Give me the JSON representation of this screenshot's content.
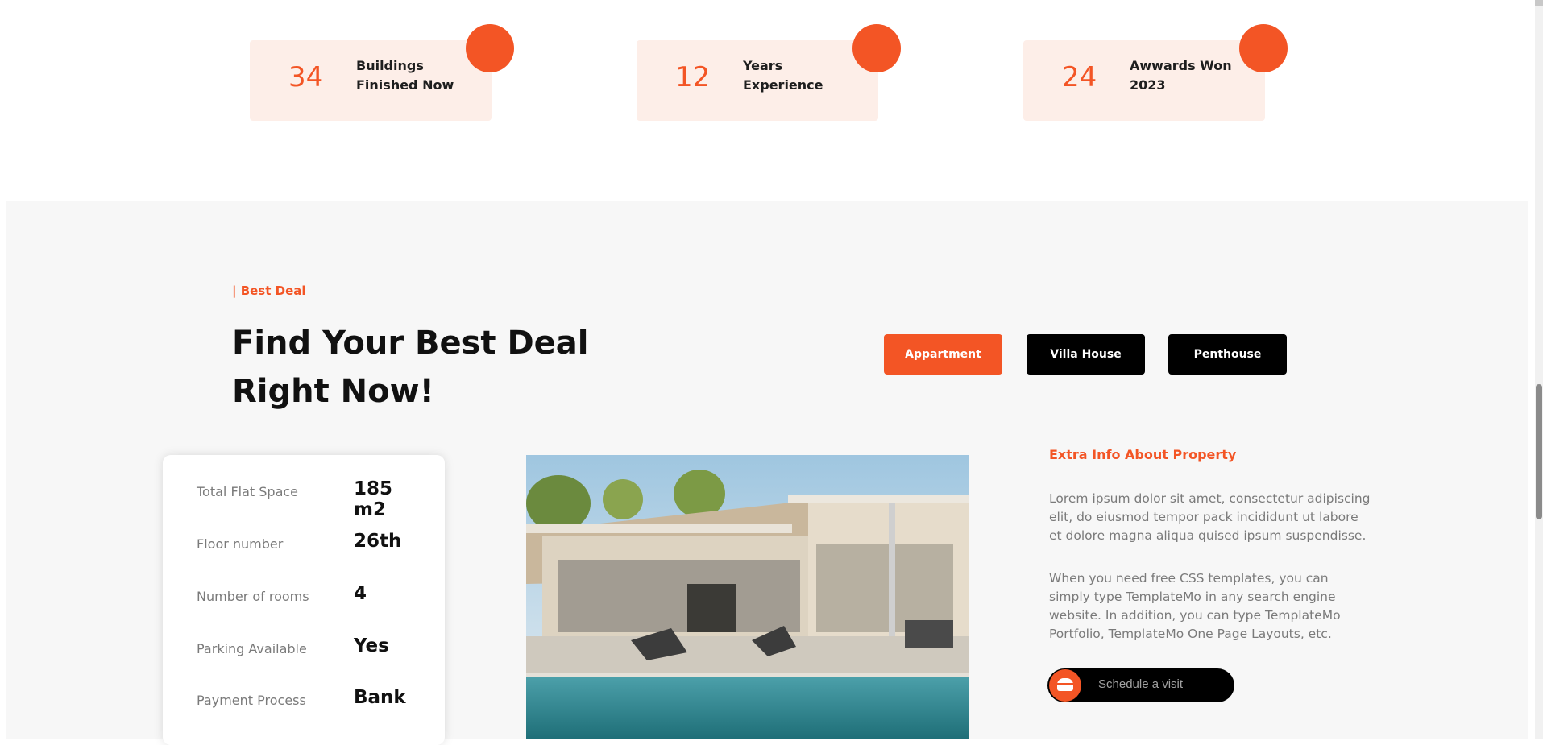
{
  "stats": [
    {
      "number": "34",
      "label": "Buildings\nFinished Now"
    },
    {
      "number": "12",
      "label": "Years\nExperience"
    },
    {
      "number": "24",
      "label": "Awwards Won\n2023"
    }
  ],
  "deal": {
    "eyebrow": "| Best Deal",
    "headline": "Find Your Best Deal Right Now!",
    "tabs": [
      {
        "label": "Appartment",
        "active": true
      },
      {
        "label": "Villa House",
        "active": false
      },
      {
        "label": "Penthouse",
        "active": false
      }
    ],
    "details": [
      {
        "label": "Total Flat Space",
        "value": "185 m2"
      },
      {
        "label": "Floor number",
        "value": "26th"
      },
      {
        "label": "Number of rooms",
        "value": "4"
      },
      {
        "label": "Parking Available",
        "value": "Yes"
      },
      {
        "label": "Payment Process",
        "value": "Bank"
      }
    ],
    "extra_title": "Extra Info About Property",
    "paragraph_1": "Lorem ipsum dolor sit amet, consectetur adipiscing elit, do eiusmod tempor pack incididunt ut labore et dolore magna aliqua quised ipsum suspendisse.",
    "paragraph_2": "When you need free CSS templates, you can simply type TemplateMo in any search engine website. In addition, you can type TemplateMo Portfolio, TemplateMo One Page Layouts, etc.",
    "schedule_label": "Schedule a visit"
  },
  "colors": {
    "accent": "#f35525",
    "card_tint": "#fdeee8",
    "section_bg": "#f7f7f7"
  }
}
